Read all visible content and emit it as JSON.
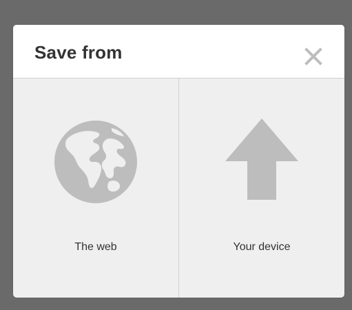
{
  "dialog": {
    "title": "Save from",
    "close_icon": "close-icon",
    "options": [
      {
        "label": "The web",
        "icon": "globe-icon"
      },
      {
        "label": "Your device",
        "icon": "upload-arrow-icon"
      }
    ]
  },
  "colors": {
    "backdrop": "#6a6a6a",
    "header_background": "#ffffff",
    "body_background": "#efefef",
    "icon": "#bdbdbd",
    "text": "#333333",
    "divider": "#cfcfcf"
  }
}
